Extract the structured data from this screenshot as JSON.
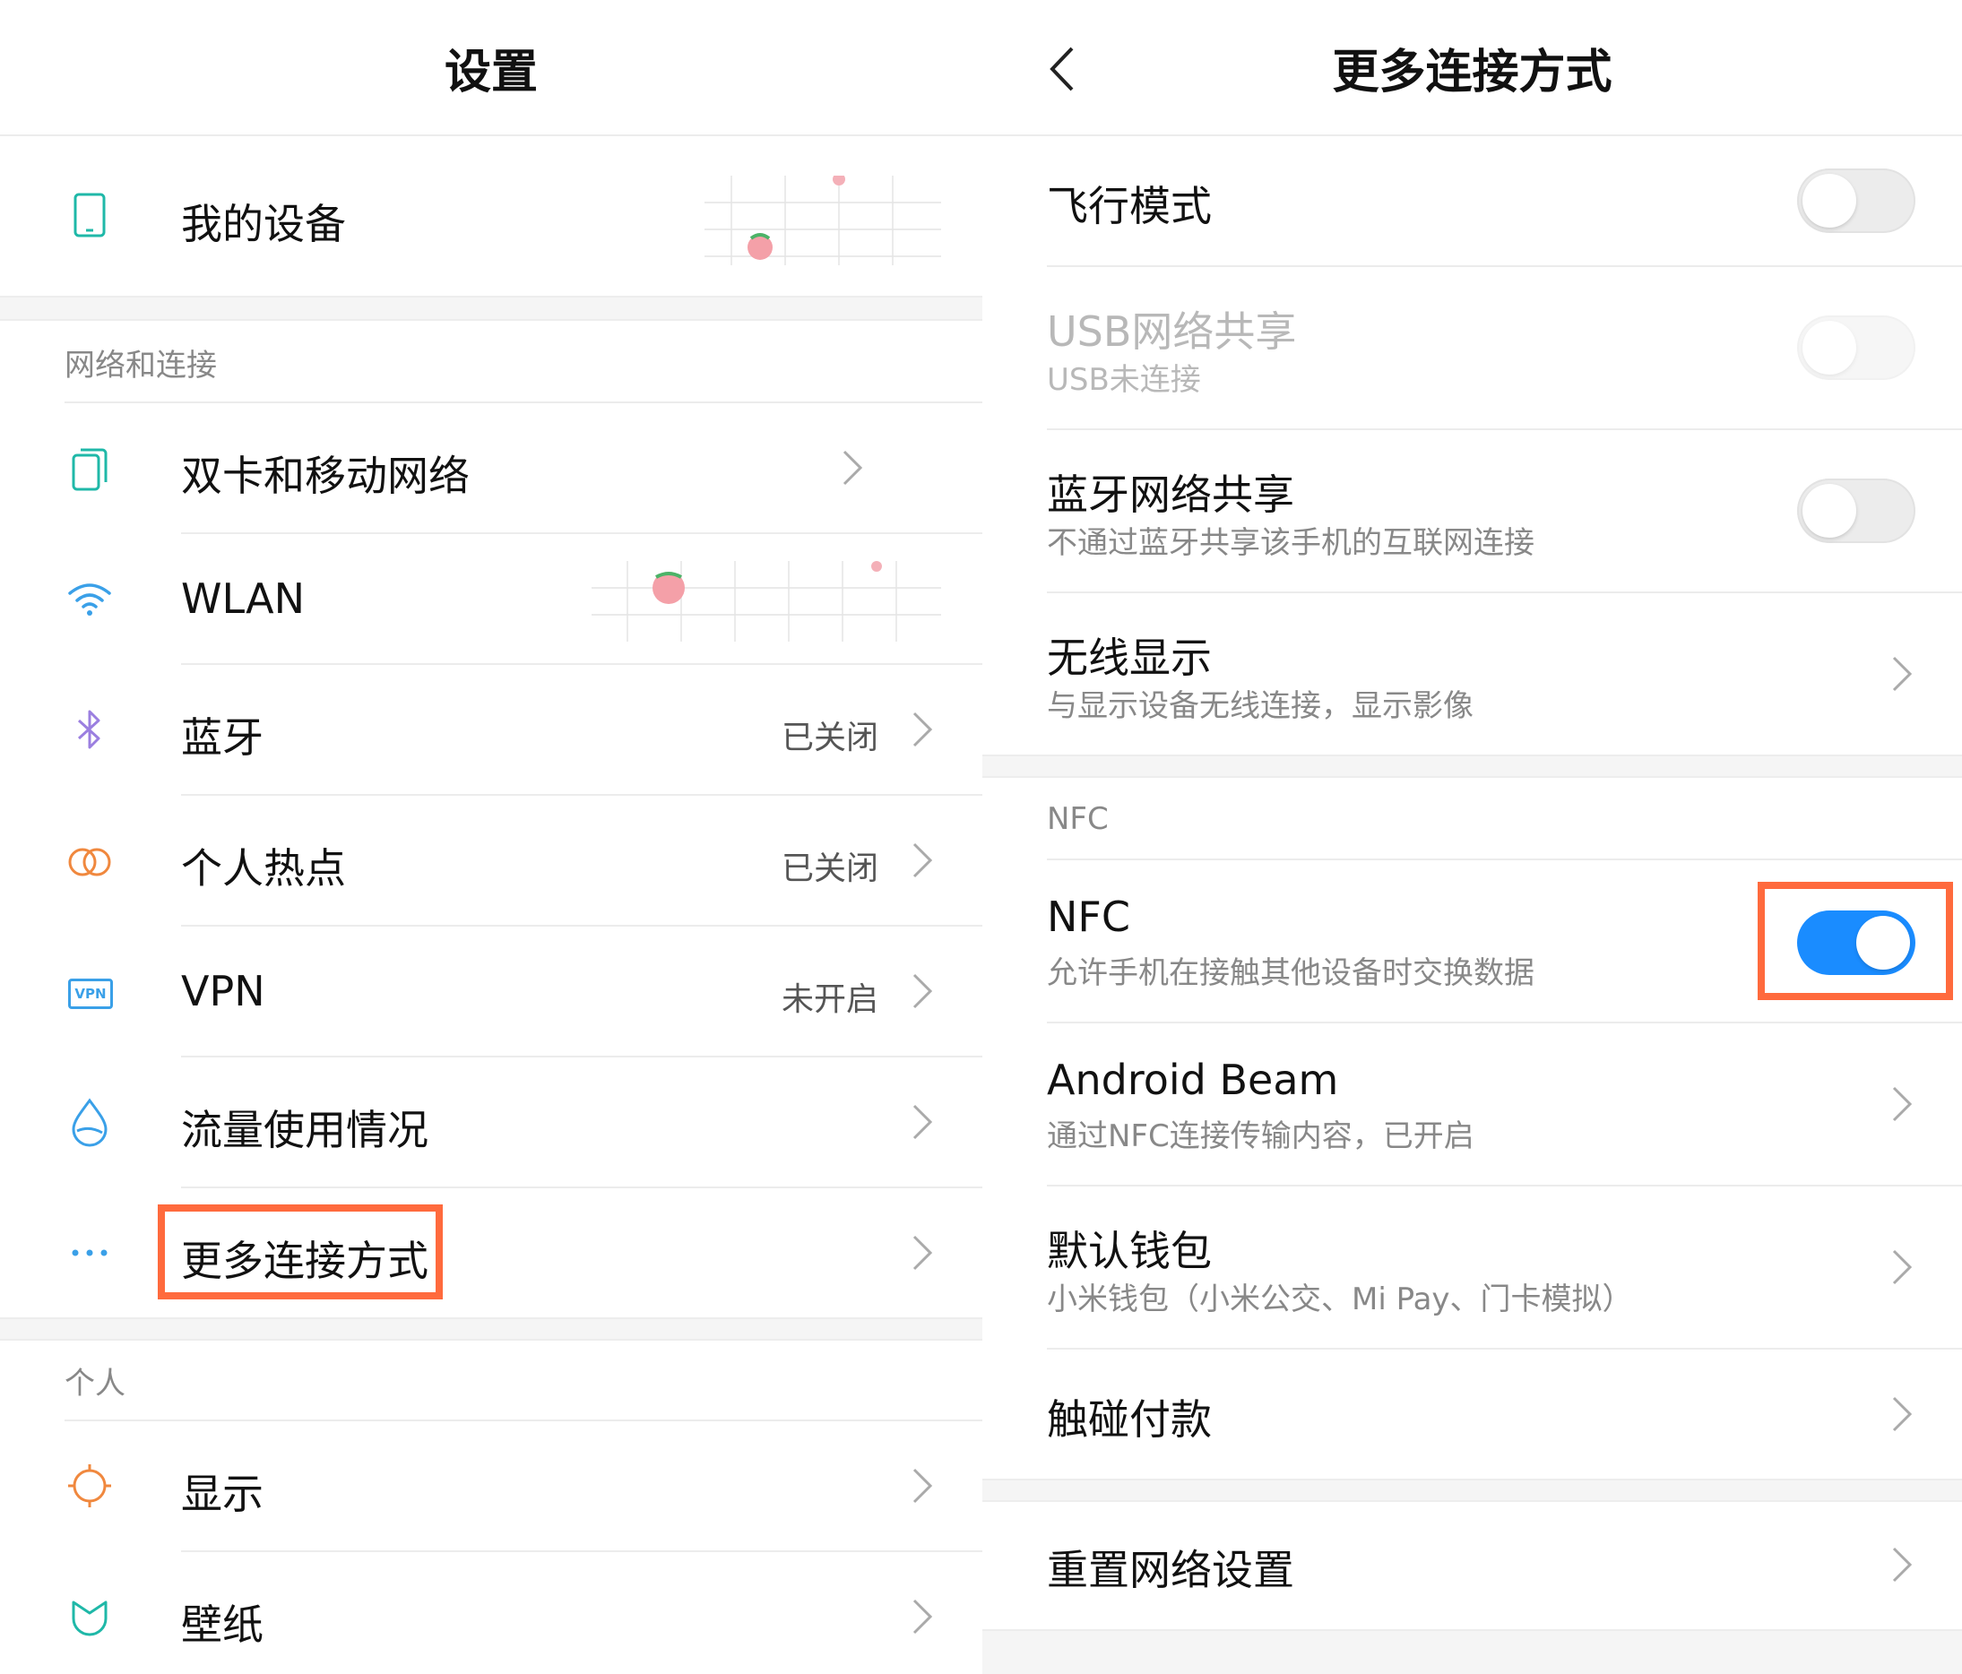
{
  "colors": {
    "accent": "#1a8cff",
    "highlight": "#ff6a3d",
    "icon_teal": "#1fb8a8",
    "icon_blue": "#3aa0e8",
    "icon_purple": "#9b7fe0",
    "icon_orange": "#f0883e"
  },
  "left": {
    "title": "设置",
    "my_device": {
      "label": "我的设备",
      "icon": "phone-icon"
    },
    "section_network": "网络和连接",
    "items": [
      {
        "label": "双卡和移动网络",
        "status": "",
        "icon": "dual-sim-icon"
      },
      {
        "label": "WLAN",
        "status": "",
        "icon": "wifi-icon"
      },
      {
        "label": "蓝牙",
        "status": "已关闭",
        "icon": "bluetooth-icon"
      },
      {
        "label": "个人热点",
        "status": "已关闭",
        "icon": "hotspot-icon"
      },
      {
        "label": "VPN",
        "status": "未开启",
        "icon": "vpn-icon"
      },
      {
        "label": "流量使用情况",
        "status": "",
        "icon": "data-usage-icon"
      },
      {
        "label": "更多连接方式",
        "status": "",
        "icon": "more-dots-icon"
      }
    ],
    "vpn_icon_text": "VPN",
    "section_personal": "个人",
    "personal_items": [
      {
        "label": "显示",
        "icon": "display-icon"
      },
      {
        "label": "壁纸",
        "icon": "wallpaper-icon"
      }
    ]
  },
  "right": {
    "title": "更多连接方式",
    "items": [
      {
        "title": "飞行模式",
        "subtitle": "",
        "control": "toggle",
        "on": false,
        "enabled": true
      },
      {
        "title": "USB网络共享",
        "subtitle": "USB未连接",
        "control": "toggle",
        "on": false,
        "enabled": false
      },
      {
        "title": "蓝牙网络共享",
        "subtitle": "不通过蓝牙共享该手机的互联网连接",
        "control": "toggle",
        "on": false,
        "enabled": true
      },
      {
        "title": "无线显示",
        "subtitle": "与显示设备无线连接，显示影像",
        "control": "chevron"
      }
    ],
    "section_nfc": "NFC",
    "nfc_items": [
      {
        "title": "NFC",
        "subtitle": "允许手机在接触其他设备时交换数据",
        "control": "toggle",
        "on": true,
        "enabled": true
      },
      {
        "title": "Android Beam",
        "subtitle": "通过NFC连接传输内容，已开启",
        "control": "chevron"
      },
      {
        "title": "默认钱包",
        "subtitle": "小米钱包（小米公交、Mi Pay、门卡模拟）",
        "control": "chevron"
      },
      {
        "title": "触碰付款",
        "subtitle": "",
        "control": "chevron"
      }
    ],
    "reset": {
      "title": "重置网络设置"
    }
  }
}
